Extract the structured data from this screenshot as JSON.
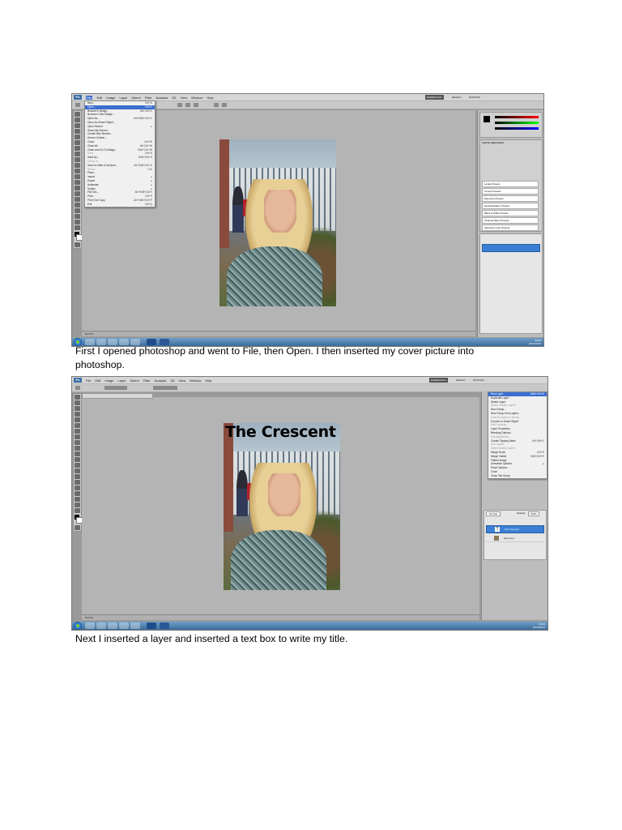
{
  "captions": {
    "first": "First I opened photoshop and went to File, then Open. I then inserted my cover picture into photoshop.",
    "second": "Next I inserted a layer and inserted a text box to write my title."
  },
  "colors": {
    "menu_highlight": "#3a6ecf",
    "selected_layer": "#3a7fd5",
    "taskbar": "#3b6d9a",
    "workspace": "#b4b4b4"
  },
  "screenshot1": {
    "app_logo": "Ps",
    "menubar": [
      "File",
      "Edit",
      "Image",
      "Layer",
      "Select",
      "Filter",
      "Analysis",
      "3D",
      "View",
      "Window",
      "Help"
    ],
    "workspaces": [
      "ESSENTIALS",
      "DESIGN",
      "PAINTING"
    ],
    "file_menu": [
      {
        "label": "New...",
        "shortcut": "Ctrl+N"
      },
      {
        "label": "Open...",
        "shortcut": "Ctrl+O",
        "highlight": true
      },
      {
        "label": "Browse in Bridge...",
        "shortcut": "Alt+Ctrl+O"
      },
      {
        "label": "Browse in Mini Bridge...",
        "shortcut": ""
      },
      {
        "label": "Open As...",
        "shortcut": "Alt+Shift+Ctrl+O"
      },
      {
        "label": "Open As Smart Object...",
        "shortcut": ""
      },
      {
        "label": "Open Recent",
        "shortcut": "▸"
      },
      {
        "label": "Share My Screen...",
        "shortcut": ""
      },
      {
        "label": "Create New Review...",
        "shortcut": ""
      },
      {
        "label": "Device Central...",
        "shortcut": ""
      },
      {
        "label": "Close",
        "shortcut": "Ctrl+W"
      },
      {
        "label": "Close All",
        "shortcut": "Alt+Ctrl+W"
      },
      {
        "label": "Close and Go To Bridge...",
        "shortcut": "Shift+Ctrl+W"
      },
      {
        "label": "Save",
        "shortcut": "Ctrl+S",
        "disabled": true
      },
      {
        "label": "Save As...",
        "shortcut": "Shift+Ctrl+S"
      },
      {
        "label": "Check In...",
        "shortcut": "",
        "disabled": true
      },
      {
        "label": "Save for Web & Devices...",
        "shortcut": "Alt+Shift+Ctrl+S"
      },
      {
        "label": "Revert",
        "shortcut": "F12",
        "disabled": true
      },
      {
        "label": "Place...",
        "shortcut": ""
      },
      {
        "label": "Import",
        "shortcut": "▸"
      },
      {
        "label": "Export",
        "shortcut": "▸"
      },
      {
        "label": "Automate",
        "shortcut": "▸"
      },
      {
        "label": "Scripts",
        "shortcut": "▸"
      },
      {
        "label": "File Info...",
        "shortcut": "Alt+Shift+Ctrl+I"
      },
      {
        "label": "Print...",
        "shortcut": "Ctrl+P"
      },
      {
        "label": "Print One Copy",
        "shortcut": "Alt+Shift+Ctrl+P"
      },
      {
        "label": "Exit",
        "shortcut": "Ctrl+Q"
      }
    ],
    "adjustments_title": "Add an adjustment",
    "presets": [
      "Levels Presets",
      "Curves Presets",
      "Exposure Presets",
      "Hue/Saturation Presets",
      "Black & White Presets",
      "Channel Mixer Presets",
      "Selective Color Presets"
    ],
    "zoom": "66.67%",
    "clock_time": "09:05",
    "clock_date": "20/10/2014"
  },
  "screenshot2": {
    "photo_title": "The Crescent",
    "layer_menu": [
      {
        "label": "New Layer...",
        "shortcut": "Shift+Ctrl+N",
        "highlight": true
      },
      {
        "label": "Duplicate Layer...",
        "shortcut": ""
      },
      {
        "label": "Delete Layer",
        "shortcut": ""
      },
      {
        "label": "Delete Hidden Layers",
        "shortcut": "",
        "disabled": true
      },
      {
        "label": "New Group...",
        "shortcut": ""
      },
      {
        "label": "New Group from Layers...",
        "shortcut": ""
      },
      {
        "label": "Lock All Layers in Group...",
        "shortcut": "",
        "disabled": true
      },
      {
        "label": "Convert to Smart Object",
        "shortcut": ""
      },
      {
        "label": "Edit Contents",
        "shortcut": "",
        "disabled": true
      },
      {
        "label": "Layer Properties...",
        "shortcut": ""
      },
      {
        "label": "Blending Options...",
        "shortcut": ""
      },
      {
        "label": "Edit Adjustment...",
        "shortcut": "",
        "disabled": true
      },
      {
        "label": "Create Clipping Mask",
        "shortcut": "Alt+Ctrl+G"
      },
      {
        "label": "Link Layers",
        "shortcut": "",
        "disabled": true
      },
      {
        "label": "Select Linked Layers",
        "shortcut": "",
        "disabled": true
      },
      {
        "label": "Merge Down",
        "shortcut": "Ctrl+E"
      },
      {
        "label": "Merge Visible",
        "shortcut": "Shift+Ctrl+E"
      },
      {
        "label": "Flatten Image",
        "shortcut": ""
      },
      {
        "label": "Animation Options",
        "shortcut": "▸"
      },
      {
        "label": "Panel Options...",
        "shortcut": ""
      },
      {
        "label": "Close",
        "shortcut": ""
      },
      {
        "label": "Close Tab Group",
        "shortcut": ""
      }
    ],
    "blend_mode": "Normal",
    "opacity_label": "Opacity:",
    "opacity": "100%",
    "layers": [
      {
        "name": "The Crescent",
        "type": "text",
        "selected": true
      },
      {
        "name": "dsc/cover",
        "type": "image",
        "selected": false
      }
    ],
    "zoom": "66.67%",
    "clock_time": "09:05",
    "clock_date": "20/10/2014"
  }
}
